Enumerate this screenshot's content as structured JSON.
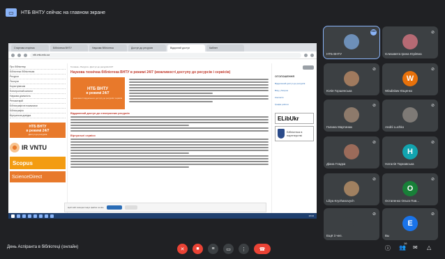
{
  "banner": {
    "text": "НТБ ВНТУ сейчас на главном экране"
  },
  "browser": {
    "tabs": [
      "Стартова сторінка",
      "Бібліотека ВНТУ",
      "Наукова бібліотека",
      "Доступ до ресурсів",
      "Відкритий доступ",
      "Кабінет"
    ],
    "address": "ntb.vntu.edu.ua"
  },
  "site": {
    "left_menu": [
      "Про бібліотеку",
      "Бібліотека бібліотекам",
      "Ресурси",
      "Послуги",
      "Користувачам",
      "Електронний каталог",
      "Наукова діяльність",
      "Репозитарій",
      "Бібліографічні покажчики",
      "Бібліографія",
      "Віртуальна довідка"
    ],
    "badge_title": "НТБ ВНТУ",
    "badge_subtitle": "в режимі 24/7",
    "badge_note": "Доступ до ресурсів",
    "irvntu": "IR VNTU",
    "scopus": "Scopus",
    "sciencedirect": "ScienceDirect",
    "breadcrumb": "Головна › Ресурси › Доступ до ресурсів 24/7",
    "heading": "Наукова технічна бібліотека ВНТУ в режимі 24/7 (можливості доступу до ресурсів і сервісів)",
    "hero_line1": "НТБ ВНТУ",
    "hero_line2": "в режимі 24/7",
    "hero_line3": "можливості віддаленого доступу до ресурсів і сервісів",
    "section1": "Віддалений доступ до електронних ресурсів",
    "section2": "Віртуальні сервіси",
    "right_heading": "ОГОЛОШЕННЯ",
    "right_links": [
      "Віддалений доступ до ресурсів",
      "Вхід у Scopus",
      "Контакти",
      "Графік роботи"
    ],
    "elib": "ELibUkr",
    "elib_partner": "Бібліотека в партнерстві",
    "cookie_text": "Цей сайт використовує файли cookie"
  },
  "taskbar": {
    "time": "10:24"
  },
  "participants": [
    {
      "name": "НТБ ВНТУ",
      "avatar": "",
      "color": "#6d8fb8",
      "active": true
    },
    {
      "name": "Єлизавета Ірина Юріївна",
      "avatar": "",
      "color": "#b66a74",
      "active": false
    },
    {
      "name": "Юлія Горшенська",
      "avatar": "",
      "color": "#a07a5e",
      "active": false
    },
    {
      "name": "Wladislaw Ющенко",
      "avatar": "W",
      "color": "#e8710a",
      "active": false
    },
    {
      "name": "Галина Мартинюк",
      "avatar": "",
      "color": "#8d7a6b",
      "active": false
    },
    {
      "name": "Andrii Luchko",
      "avatar": "",
      "color": "#7e7a76",
      "active": false
    },
    {
      "name": "Діана Гладка",
      "avatar": "",
      "color": "#9b6b5a",
      "active": false
    },
    {
      "name": "Наталія Тарнавська",
      "avatar": "H",
      "color": "#12a4af",
      "active": false
    },
    {
      "name": "Liliya Kryzhanovych",
      "avatar": "",
      "color": "#a08060",
      "active": false
    },
    {
      "name": "Остапенко Ольга Пав...",
      "avatar": "O",
      "color": "#188038",
      "active": false
    },
    {
      "name": "Ещё 3 чел.",
      "avatar": "",
      "color": "#3c4043",
      "active": false
    },
    {
      "name": "Вы",
      "avatar": "E",
      "color": "#1a73e8",
      "active": false
    }
  ],
  "bottom": {
    "meeting_name": "День Аспіранта в бібліотеці (онлайн)",
    "participant_count": "16"
  }
}
